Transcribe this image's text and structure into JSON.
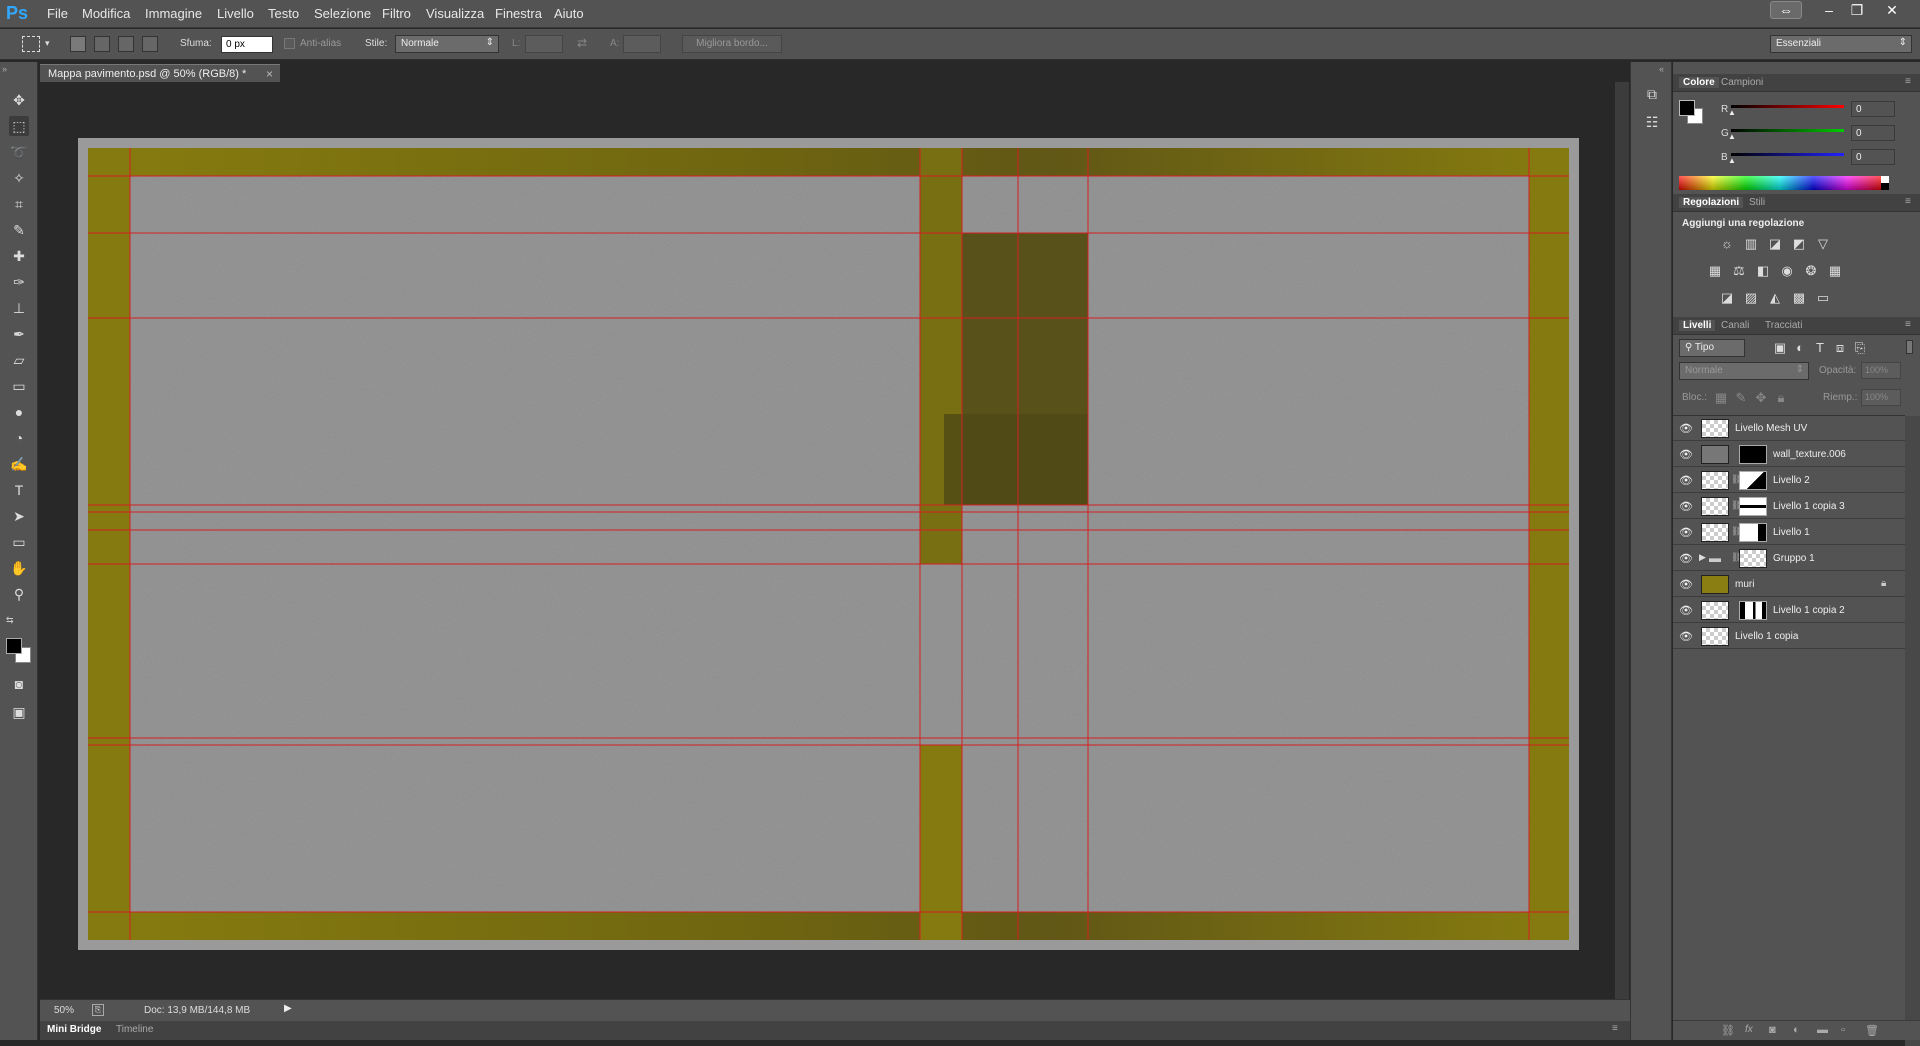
{
  "app": {
    "logo": "Ps"
  },
  "menu": [
    "File",
    "Modifica",
    "Immagine",
    "Livello",
    "Testo",
    "Selezione",
    "Filtro",
    "Visualizza",
    "Finestra",
    "Aiuto"
  ],
  "window_controls": {
    "arrange": "⇔",
    "minimize": "–",
    "restore": "❐",
    "close": "✕"
  },
  "options": {
    "feather_label": "Sfuma:",
    "feather_value": "0 px",
    "antialias_label": "Anti-alias",
    "style_label": "Stile:",
    "style_value": "Normale",
    "width_label": "L:",
    "height_label": "A:",
    "refine_button": "Migliora bordo...",
    "workspace": "Essenziali"
  },
  "document": {
    "tab_title": "Mappa pavimento.psd @ 50% (RGB/8) *",
    "tab_close": "×"
  },
  "status": {
    "zoom": "50%",
    "doc_info": "Doc: 13,9 MB/144,8 MB"
  },
  "bottom_tabs": [
    "Mini Bridge",
    "Timeline"
  ],
  "color_panel": {
    "tabs": [
      "Colore",
      "Campioni"
    ],
    "channels": [
      {
        "label": "R",
        "value": "0",
        "color": "#e02020"
      },
      {
        "label": "G",
        "value": "0",
        "color": "#20c020"
      },
      {
        "label": "B",
        "value": "0",
        "color": "#2040e0"
      }
    ]
  },
  "adjustments_panel": {
    "tabs": [
      "Regolazioni",
      "Stili"
    ],
    "heading": "Aggiungi una regolazione"
  },
  "layers_panel": {
    "tabs": [
      "Livelli",
      "Canali",
      "Tracciati"
    ],
    "filter_type": "Tipo",
    "blend_mode": "Normale",
    "opacity_label": "Opacità:",
    "opacity_value": "100%",
    "lock_label": "Bloc.:",
    "fill_label": "Riemp.:",
    "fill_value": "100%",
    "layers": [
      {
        "name": "Livello Mesh UV"
      },
      {
        "name": "wall_texture.006"
      },
      {
        "name": "Livello 2"
      },
      {
        "name": "Livello 1 copia 3"
      },
      {
        "name": "Livello 1"
      },
      {
        "name": "Gruppo 1"
      },
      {
        "name": "muri"
      },
      {
        "name": "Livello 1 copia 2"
      },
      {
        "name": "Livello 1 copia"
      }
    ]
  },
  "colors": {
    "accent": "#31a8ff",
    "guide": "#d42020",
    "wall": "#8a7e12",
    "floor": "#8c8c8c"
  }
}
